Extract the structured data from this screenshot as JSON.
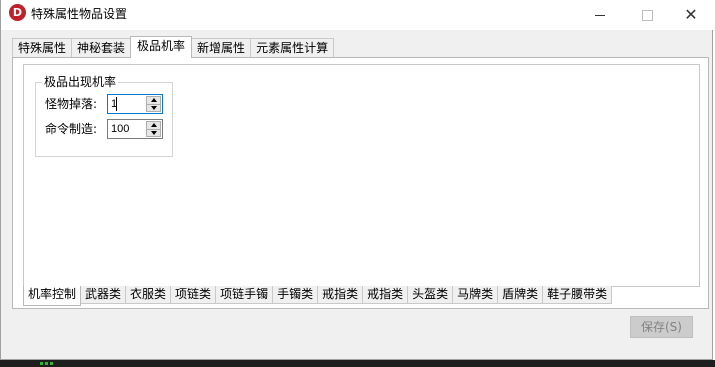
{
  "window": {
    "title": "特殊属性物品设置",
    "app_icon_letter": "D"
  },
  "top_tabs": [
    {
      "label": "特殊属性",
      "active": false
    },
    {
      "label": "神秘套装",
      "active": false
    },
    {
      "label": "极品机率",
      "active": true
    },
    {
      "label": "新增属性",
      "active": false
    },
    {
      "label": "元素属性计算",
      "active": false
    }
  ],
  "probability_group": {
    "title": "极品出现机率",
    "fields": [
      {
        "label": "怪物掉落:",
        "value": "1",
        "focused": true
      },
      {
        "label": "命令制造:",
        "value": "100",
        "focused": false
      }
    ]
  },
  "bottom_tabs": [
    {
      "label": "机率控制",
      "active": true
    },
    {
      "label": "武器类",
      "active": false
    },
    {
      "label": "衣服类",
      "active": false
    },
    {
      "label": "项链类",
      "active": false
    },
    {
      "label": "项链手镯",
      "active": false
    },
    {
      "label": "手镯类",
      "active": false
    },
    {
      "label": "戒指类",
      "active": false
    },
    {
      "label": "戒指类",
      "active": false
    },
    {
      "label": "头盔类",
      "active": false
    },
    {
      "label": "马牌类",
      "active": false
    },
    {
      "label": "盾牌类",
      "active": false
    },
    {
      "label": "鞋子腰带类",
      "active": false
    }
  ],
  "footer": {
    "save_label": "保存(S)"
  },
  "colors": {
    "app_icon": "#c0202a",
    "focus_border": "#0078d7",
    "disabled_button": "#cccccc"
  }
}
